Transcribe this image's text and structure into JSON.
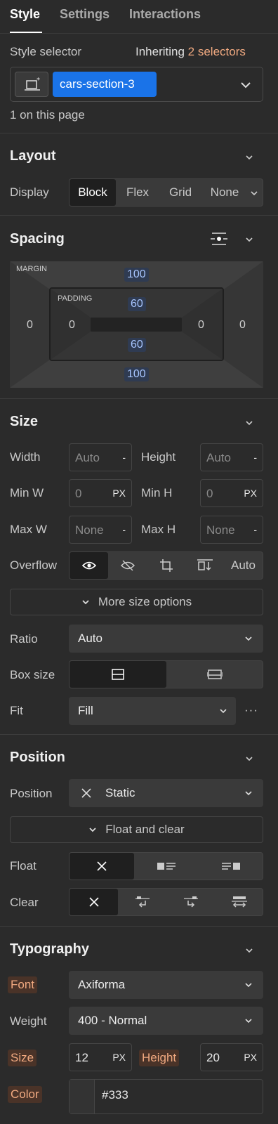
{
  "tabs": [
    {
      "label": "Style",
      "active": true
    },
    {
      "label": "Settings",
      "active": false
    },
    {
      "label": "Interactions",
      "active": false
    }
  ],
  "selector": {
    "label": "Style selector",
    "inheriting_prefix": "Inheriting",
    "inheriting_count": "2 selectors",
    "class_name": "cars-section-3",
    "on_page": "1 on this page"
  },
  "layout": {
    "title": "Layout",
    "display_label": "Display",
    "display_options": [
      "Block",
      "Flex",
      "Grid",
      "None"
    ],
    "display_selected": "Block"
  },
  "spacing": {
    "title": "Spacing",
    "margin_label": "MARGIN",
    "padding_label": "PADDING",
    "margin": {
      "top": "100",
      "right": "0",
      "bottom": "100",
      "left": "0"
    },
    "padding": {
      "top": "60",
      "right": "0",
      "bottom": "60",
      "left": "0"
    }
  },
  "size": {
    "title": "Size",
    "width_label": "Width",
    "width_value": "Auto",
    "width_unit": "-",
    "height_label": "Height",
    "height_value": "Auto",
    "height_unit": "-",
    "minw_label": "Min W",
    "minw_value": "0",
    "minw_unit": "PX",
    "minh_label": "Min H",
    "minh_value": "0",
    "minh_unit": "PX",
    "maxw_label": "Max W",
    "maxw_value": "None",
    "maxw_unit": "-",
    "maxh_label": "Max H",
    "maxh_value": "None",
    "maxh_unit": "-",
    "overflow_label": "Overflow",
    "overflow_icons": [
      "eye-icon",
      "eye-slash-icon",
      "crop-icon",
      "scroll-icon"
    ],
    "overflow_auto": "Auto",
    "more_options": "More size options",
    "ratio_label": "Ratio",
    "ratio_value": "Auto",
    "boxsize_label": "Box size",
    "fit_label": "Fit",
    "fit_value": "Fill",
    "fit_more": "···"
  },
  "position": {
    "title": "Position",
    "position_label": "Position",
    "position_value": "Static",
    "float_clear": "Float and clear",
    "float_label": "Float",
    "clear_label": "Clear"
  },
  "typography": {
    "title": "Typography",
    "font_label": "Font",
    "font_value": "Axiforma",
    "weight_label": "Weight",
    "weight_value": "400 - Normal",
    "size_label": "Size",
    "size_value": "12",
    "size_unit": "PX",
    "height_label": "Height",
    "height_value": "20",
    "height_unit": "PX",
    "color_label": "Color",
    "color_value": "#333"
  },
  "colors": {
    "accent_orange": "#f0a980",
    "selector_blue": "#1a73e8",
    "panel_bg": "#2b2b2b"
  }
}
